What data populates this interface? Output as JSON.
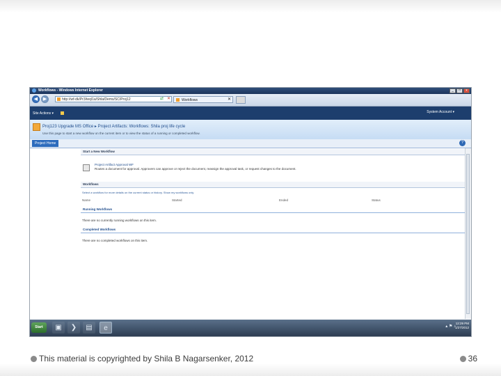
{
  "window": {
    "title": "Workflows - Windows Internet Explorer",
    "min": "_",
    "max": "□",
    "close": "x"
  },
  "browser": {
    "address": "http://wf-dk/Pr3/teql1a/Shla/Dems/SC/Proj12",
    "tab_title": "Workflows",
    "back_icon": "back-arrow-icon",
    "forward_icon": "forward-arrow-icon"
  },
  "sharepoint": {
    "site_actions": "Site Actions ▾",
    "system_account": "System Account ▾",
    "breadcrumb": "Proj123 Upgrade MS Office ▸ Project Artifacts: Workflows: Shila proj life cycle",
    "description": "Use this page to start a new workflow on the current item or to view the status of a running or completed workflow.",
    "nav_tab": "Project Home",
    "help": "?"
  },
  "start_section": {
    "header": "Start a New Workflow",
    "workflow_name": "Project Artifact Approval WF",
    "workflow_desc": "Routes a document for approval. Approvers can approve or reject the document, reassign the approval task, or request changes to the document."
  },
  "workflows_section": {
    "header": "Workflows",
    "hint": "Select a workflow for more details on the current status or history.   Show my workflows only",
    "columns": [
      "Name",
      "Started",
      "Ended",
      "Status"
    ],
    "running_header": "Running Workflows",
    "running_msg": "There are no currently running workflows on this item.",
    "completed_header": "Completed Workflows",
    "completed_msg": "There are no completed workflows on this item."
  },
  "taskbar": {
    "start": "Start",
    "clock_time": "12:29 PM",
    "clock_date": "1/27/2012"
  },
  "footer": {
    "text": "This material is copyrighted by Shila B Nagarsenker, 2012",
    "page": "36"
  }
}
